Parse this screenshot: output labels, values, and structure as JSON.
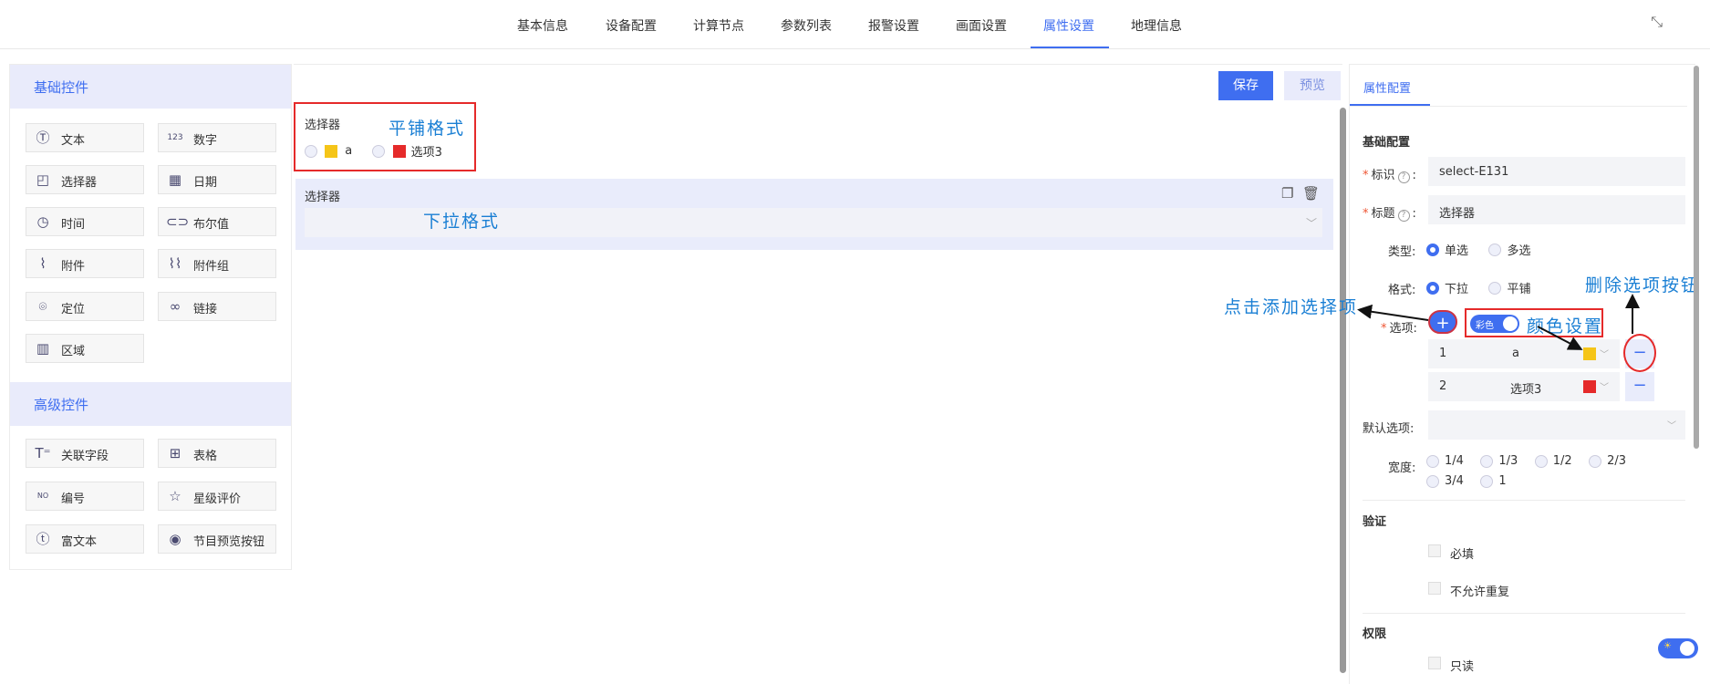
{
  "tabs": [
    "基本信息",
    "设备配置",
    "计算节点",
    "参数列表",
    "报警设置",
    "画面设置",
    "属性设置",
    "地理信息"
  ],
  "active_tab": "属性设置",
  "left_panel": {
    "basic_title": "基础控件",
    "basic_controls": [
      {
        "label": "文本",
        "icon": "text-icon"
      },
      {
        "label": "数字",
        "icon": "number-icon"
      },
      {
        "label": "选择器",
        "icon": "selector-icon"
      },
      {
        "label": "日期",
        "icon": "calendar-icon"
      },
      {
        "label": "时间",
        "icon": "clock-icon"
      },
      {
        "label": "布尔值",
        "icon": "toggle-icon"
      },
      {
        "label": "附件",
        "icon": "paperclip-icon"
      },
      {
        "label": "附件组",
        "icon": "paperclips-icon"
      },
      {
        "label": "定位",
        "icon": "location-icon"
      },
      {
        "label": "链接",
        "icon": "link-icon"
      },
      {
        "label": "区域",
        "icon": "map-icon"
      }
    ],
    "advanced_title": "高级控件",
    "advanced_controls": [
      {
        "label": "关联字段",
        "icon": "related-field-icon"
      },
      {
        "label": "表格",
        "icon": "table-icon"
      },
      {
        "label": "编号",
        "icon": "number-badge-icon"
      },
      {
        "label": "星级评价",
        "icon": "star-icon"
      },
      {
        "label": "富文本",
        "icon": "rich-text-icon"
      },
      {
        "label": "节目预览按钮",
        "icon": "eye-icon"
      }
    ]
  },
  "canvas": {
    "save_label": "保存",
    "preview_label": "预览",
    "tiled": {
      "title": "选择器",
      "options": [
        {
          "label": "a",
          "color": "#f5c518"
        },
        {
          "label": "选项3",
          "color": "#e52a2a"
        }
      ]
    },
    "dropdown": {
      "title": "选择器"
    }
  },
  "annotations": {
    "tiled_format": "平铺格式",
    "dropdown_format": "下拉格式",
    "add_option": "点击添加选择项",
    "color_setting": "颜色设置",
    "delete_option": "删除选项按钮"
  },
  "props": {
    "tab": "属性配置",
    "basic_config": "基础配置",
    "id_label": "标识",
    "id_value": "select-E131",
    "title_label": "标题",
    "title_value": "选择器",
    "type_label": "类型:",
    "type_options": [
      "单选",
      "多选"
    ],
    "format_label": "格式:",
    "format_options": [
      "下拉",
      "平铺"
    ],
    "options_label": "选项:",
    "color_toggle": "彩色",
    "option_rows": [
      {
        "index": "1",
        "label": "a",
        "color": "#f5c518"
      },
      {
        "index": "2",
        "label": "选项3",
        "color": "#e52a2a"
      }
    ],
    "default_label": "默认选项:",
    "width_label": "宽度:",
    "width_options": [
      "1/4",
      "1/3",
      "1/2",
      "2/3",
      "3/4",
      "1"
    ],
    "validate_title": "验证",
    "required_label": "必填",
    "no_dup_label": "不允许重复",
    "perm_title": "权限",
    "readonly_label": "只读",
    "accent": "#3f6ef0"
  }
}
